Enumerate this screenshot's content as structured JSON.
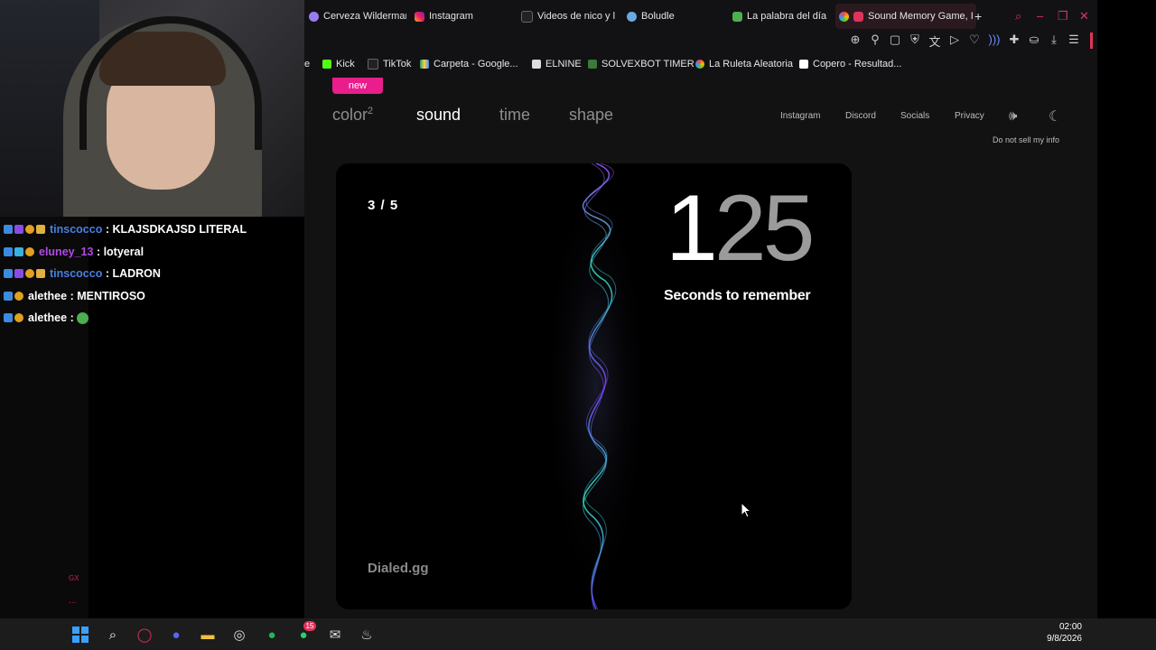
{
  "chat": [
    {
      "user": "tinscocco",
      "message": "KLAJSDKAJSD LITERAL",
      "color": "#4a7ee0"
    },
    {
      "user": "eluney_13",
      "message": "lotyeral",
      "color": "#b24ae6"
    },
    {
      "user": "tinscocco",
      "message": "LADRON",
      "color": "#4a7ee0"
    },
    {
      "user": "alethee",
      "message": "MENTIROSO",
      "color": "#ffffff"
    },
    {
      "user": "alethee",
      "message": "",
      "color": "#ffffff"
    }
  ],
  "sidebar": {
    "gx_label": "GX",
    "dots": "..."
  },
  "tabs": [
    {
      "label": "Cerveza Wilderman",
      "icon": "sparkle-icon"
    },
    {
      "label": "Instagram",
      "icon": "instagram-icon"
    },
    {
      "label": "Videos de nico y lu",
      "icon": "tiktok-icon"
    },
    {
      "label": "Boludle",
      "icon": "globe-icon"
    },
    {
      "label": "La palabra del día",
      "icon": "p-icon"
    },
    {
      "label": "Sound Memory Game, I",
      "icon": "speaker-icon",
      "active": true
    }
  ],
  "bookmarks": [
    {
      "label": "e"
    },
    {
      "label": "Kick"
    },
    {
      "label": "TikTok"
    },
    {
      "label": "Carpeta - Google..."
    },
    {
      "label": "ELNINE"
    },
    {
      "label": "SOLVEXBOT TIMER"
    },
    {
      "label": "La Ruleta Aleatoria"
    },
    {
      "label": "Copero - Resultad..."
    }
  ],
  "site": {
    "new_badge": "new",
    "nav": {
      "color": "color",
      "color_sup": "2",
      "sound": "sound",
      "time": "time",
      "shape": "shape"
    },
    "links": {
      "instagram": "Instagram",
      "discord": "Discord",
      "socials": "Socials",
      "privacy": "Privacy",
      "do_not_sell": "Do not sell my info"
    }
  },
  "game": {
    "round": "3 / 5",
    "counter_first": "1",
    "counter_rest": "25",
    "counter_label": "Seconds to remember",
    "brand": "Dialed.gg"
  },
  "taskbar": {
    "time": "02:00",
    "date": "9/8/2026",
    "whatsapp_badge": "15"
  },
  "colors": {
    "accent": "#e91e8c",
    "browser_red": "#e0335a"
  }
}
